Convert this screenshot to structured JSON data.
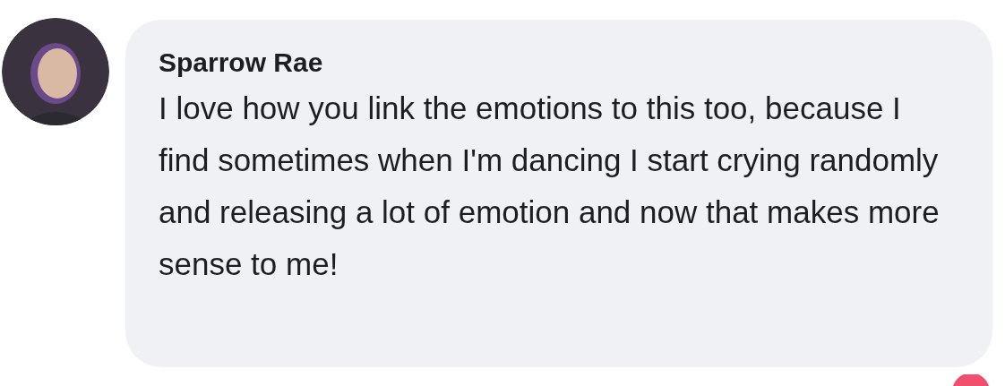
{
  "comment": {
    "author": "Sparrow Rae",
    "text": "I love how you link the emotions to this too, because I find sometimes when I'm dancing I start crying randomly and releasing a lot of emotion and now that makes more sense to me!"
  }
}
